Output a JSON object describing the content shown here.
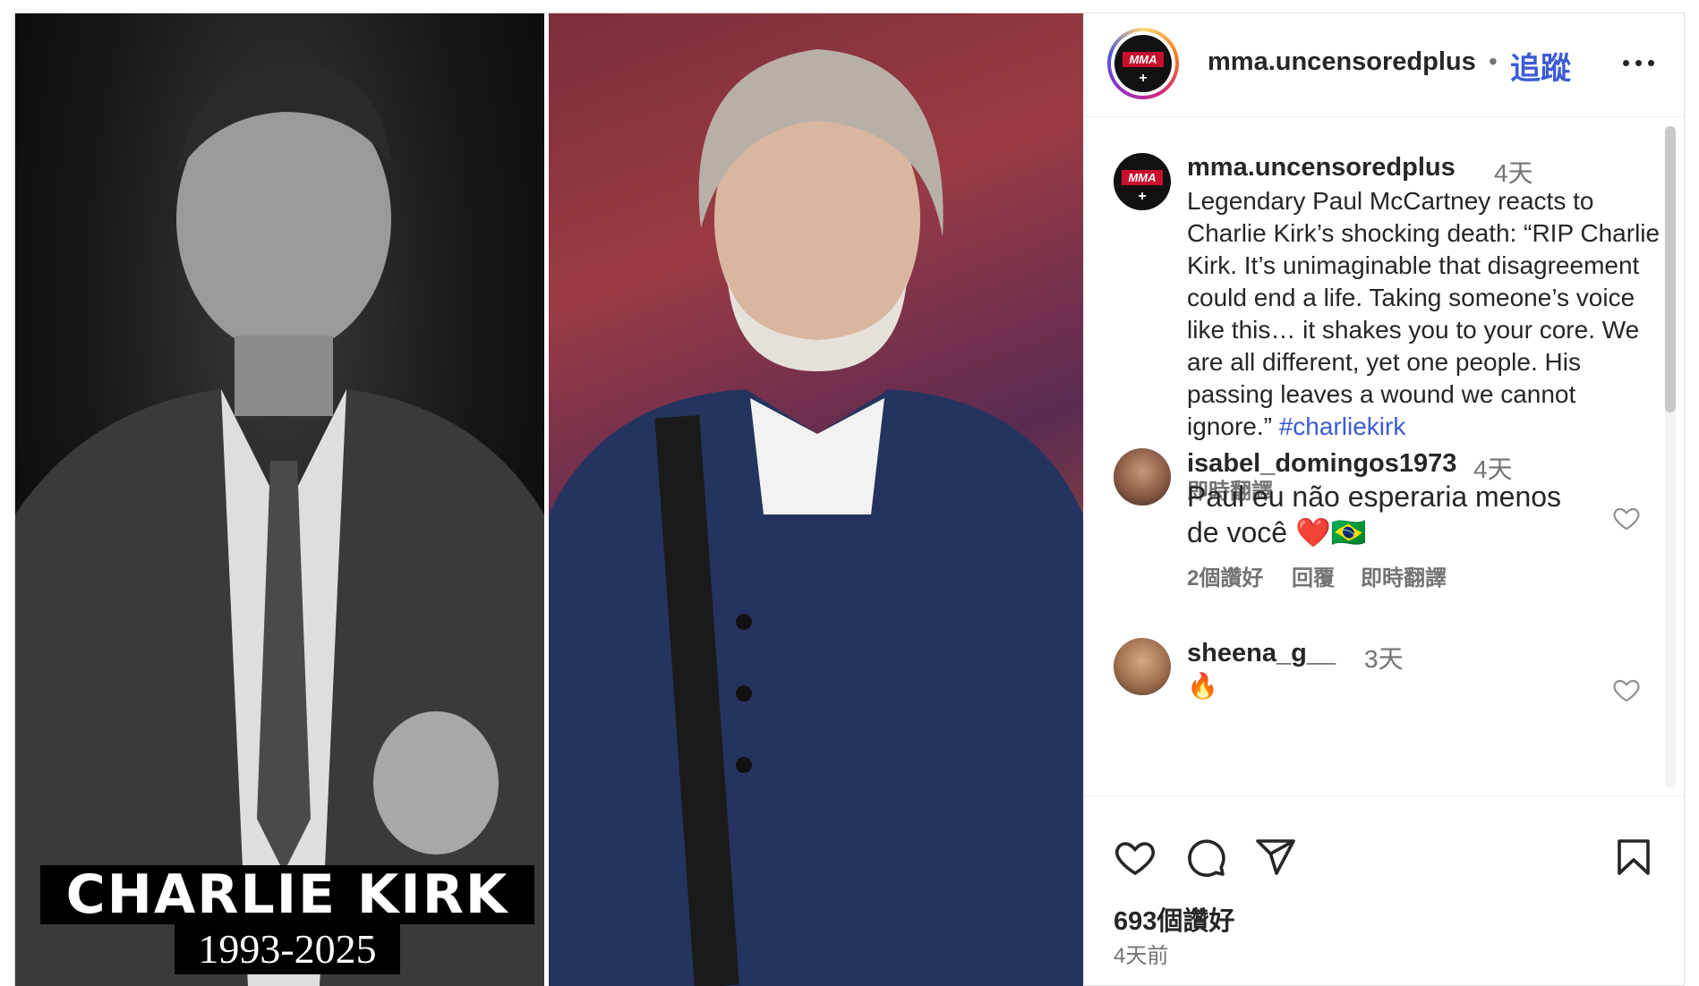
{
  "image": {
    "left_caption_name": "CHARLIE KIRK",
    "left_caption_years": "1993-2025"
  },
  "header": {
    "username": "mma.uncensoredplus",
    "separator": "•",
    "follow_label": "追蹤"
  },
  "caption": {
    "username": "mma.uncensoredplus",
    "time": "4天",
    "text": "Legendary Paul McCartney reacts to Charlie Kirk’s shocking death: “RIP Charlie Kirk. It’s unimaginable that disagreement could end a life. Taking someone’s voice like this… it shakes you to your core. We are all different, yet one people. His passing leaves a wound we cannot ignore.” ",
    "hashtag": "#charliekirk",
    "translate_label": "即時翻譯"
  },
  "comments": [
    {
      "username": "isabel_domingos1973",
      "time": "4天",
      "text": "Paul eu não esperaria menos de você ❤️🇧🇷",
      "likes": "2個讚好",
      "reply_label": "回覆",
      "translate_label": "即時翻譯"
    },
    {
      "username": "sheena_g__",
      "time": "3天",
      "text": "🔥"
    }
  ],
  "actions": {
    "like_count": "693個讚好",
    "posted_ago": "4天前",
    "icons": [
      "heart-icon",
      "comment-icon",
      "share-icon",
      "bookmark-icon"
    ]
  },
  "avatar_logo_text": "MMA",
  "colors": {
    "link": "#3b5bd6",
    "muted": "#737373",
    "text": "#262626",
    "border": "#dbdbdb"
  }
}
